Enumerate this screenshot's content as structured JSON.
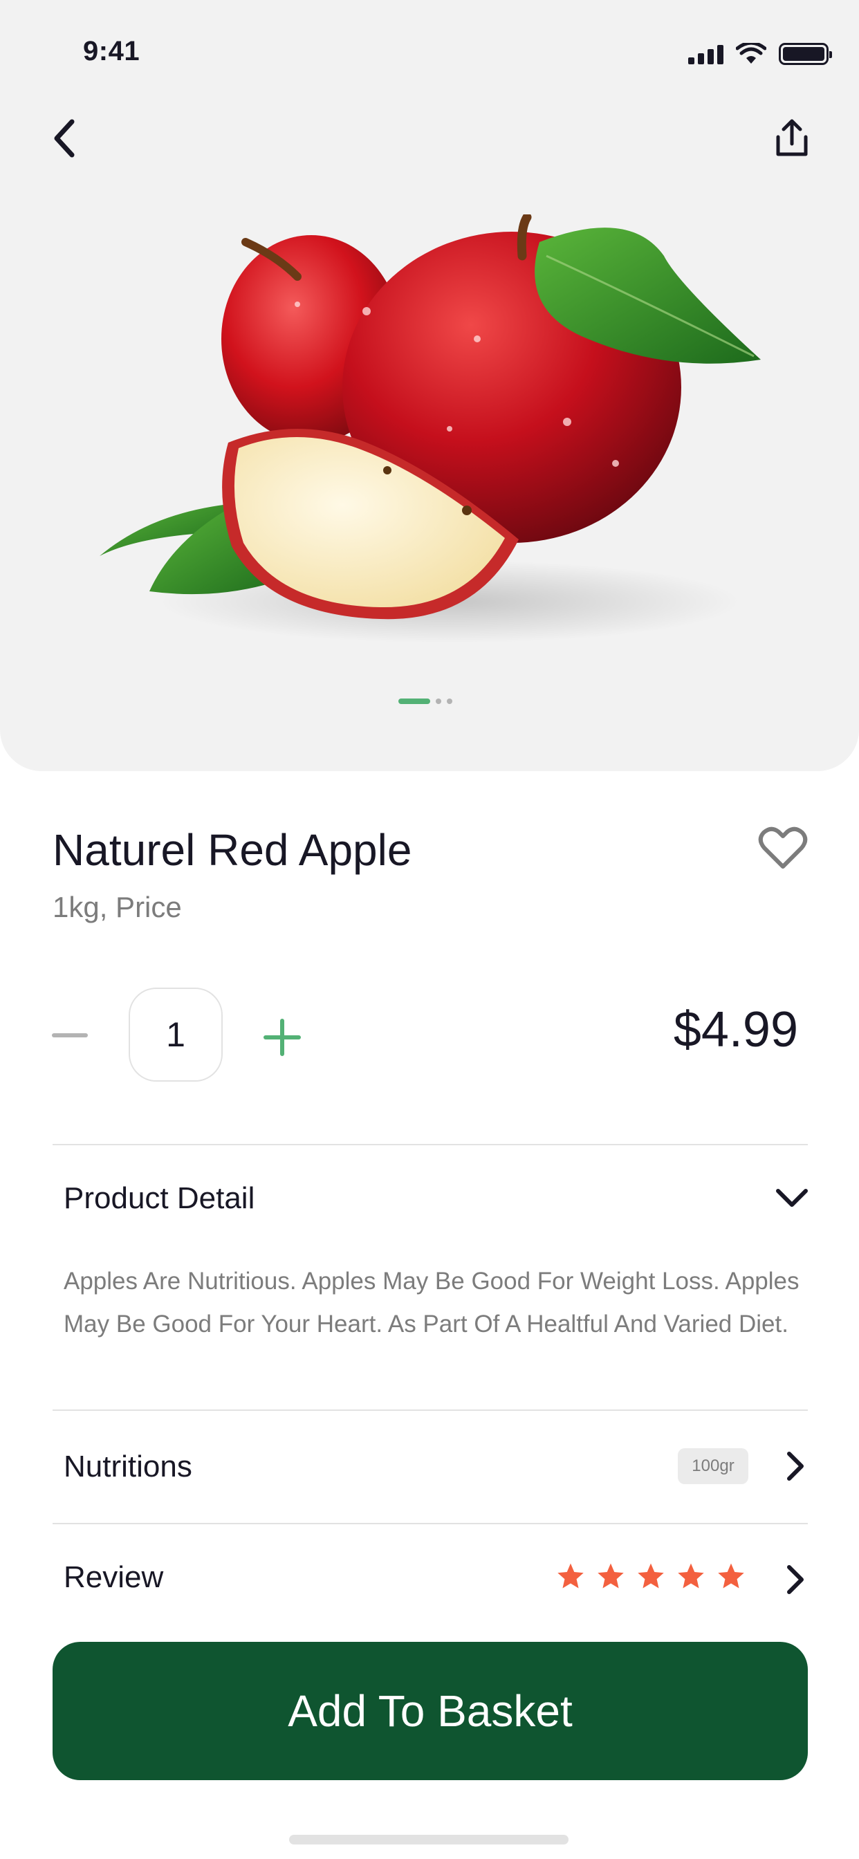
{
  "status_bar": {
    "time": "9:41"
  },
  "product": {
    "name": "Naturel Red Apple",
    "unit": "1kg, Price",
    "quantity": "1",
    "price": "$4.99"
  },
  "carousel": {
    "pages": 3,
    "active_index": 0
  },
  "sections": {
    "detail": {
      "label": "Product Detail",
      "description": "Apples Are Nutritious. Apples May Be Good For Weight Loss. Apples May Be Good For Your Heart. As Part Of A Healtful And Varied Diet."
    },
    "nutritions": {
      "label": "Nutritions",
      "badge": "100gr"
    },
    "review": {
      "label": "Review",
      "rating": 5,
      "max_rating": 5
    }
  },
  "cta": {
    "label": "Add To Basket"
  },
  "colors": {
    "accent_green": "#53b175",
    "button_green": "#0f5530",
    "star_orange": "#f3603f",
    "hero_bg": "#f2f2f2"
  },
  "icons": [
    "back-arrow-icon",
    "share-icon",
    "heart-icon",
    "minus-icon",
    "plus-icon",
    "chevron-down-icon",
    "chevron-right-icon",
    "star-icon"
  ]
}
